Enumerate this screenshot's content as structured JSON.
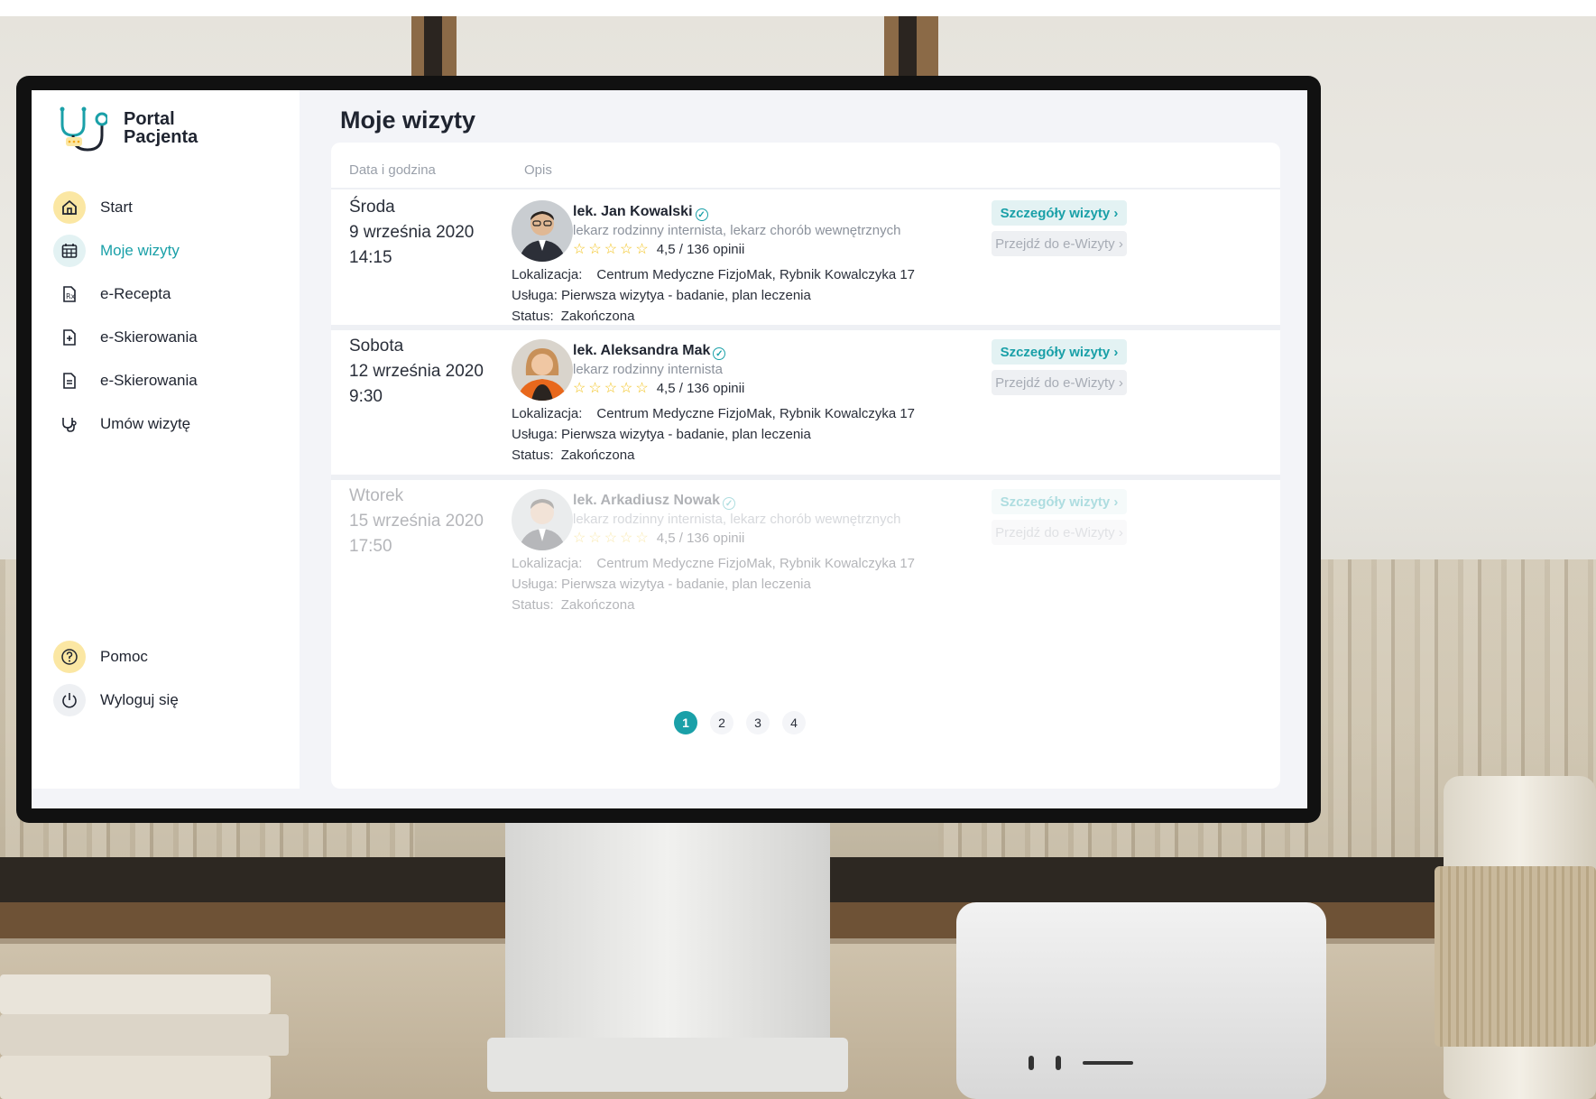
{
  "brand": {
    "line1": "Portal",
    "line2": "Pacjenta"
  },
  "sidebar": {
    "items": [
      {
        "label": "Start",
        "icon": "home-icon"
      },
      {
        "label": "Moje wizyty",
        "icon": "calendar-icon",
        "active": true
      },
      {
        "label": "e-Recepta",
        "icon": "prescription-icon"
      },
      {
        "label": "e-Skierowania",
        "icon": "file-plus-icon"
      },
      {
        "label": "e-Skierowania",
        "icon": "document-icon"
      },
      {
        "label": "Umów wizytę",
        "icon": "stethoscope-icon"
      }
    ],
    "bottom": [
      {
        "label": "Pomoc",
        "icon": "help-icon"
      },
      {
        "label": "Wyloguj się",
        "icon": "power-icon"
      }
    ]
  },
  "page": {
    "title": "Moje wizyty"
  },
  "table": {
    "headers": [
      "Data i godzina",
      "Opis"
    ],
    "rows": [
      {
        "day": "Środa",
        "date": "9 września 2020",
        "time": "14:15",
        "doctor": "lek. Jan Kowalski",
        "specialty": "lekarz rodzinny  internista, lekarz chorób wewnętrznych",
        "rating": "4,5 / 136 opinii",
        "location_label": "Lokalizacja:",
        "location": "Centrum Medyczne FizjoMak, Rybnik Kowalczyka 17",
        "service_label": "Usługa:",
        "service": "Pierwsza wizytya - badanie, plan leczenia",
        "status_label": "Status:",
        "status": "Zakończona",
        "details_btn": "Szczegóły wizyty  ›",
        "ewizyta_btn": "Przejdź do e-Wizyty ›"
      },
      {
        "day": "Sobota",
        "date": "12 września 2020",
        "time": "9:30",
        "doctor": "lek. Aleksandra Mak",
        "specialty": "lekarz rodzinny  internista",
        "rating": "4,5 / 136 opinii",
        "location_label": "Lokalizacja:",
        "location": "Centrum Medyczne FizjoMak, Rybnik Kowalczyka 17",
        "service_label": "Usługa:",
        "service": "Pierwsza wizytya - badanie, plan leczenia",
        "status_label": "Status:",
        "status": "Zakończona",
        "details_btn": "Szczegóły wizyty  ›",
        "ewizyta_btn": "Przejdź do e-Wizyty ›"
      },
      {
        "day": "Wtorek",
        "date": "15 września 2020",
        "time": "17:50",
        "doctor": "lek. Arkadiusz Nowak",
        "specialty": "lekarz rodzinny  internista, lekarz chorób wewnętrznych",
        "rating": "4,5 / 136 opinii",
        "location_label": "Lokalizacja:",
        "location": "Centrum Medyczne FizjoMak, Rybnik Kowalczyka 17",
        "service_label": "Usługa:",
        "service": "Pierwsza wizytya - badanie, plan leczenia",
        "status_label": "Status:",
        "status": "Zakończona",
        "details_btn": "Szczegóły wizyty  ›",
        "ewizyta_btn": "Przejdź do e-Wizyty ›"
      }
    ],
    "stars": "☆☆☆☆☆"
  },
  "pagination": {
    "pages": [
      "1",
      "2",
      "3",
      "4"
    ],
    "current": "1"
  },
  "colors": {
    "accent": "#1aa0a8",
    "star": "#f2c21b",
    "highlight": "#fbe7a3"
  }
}
